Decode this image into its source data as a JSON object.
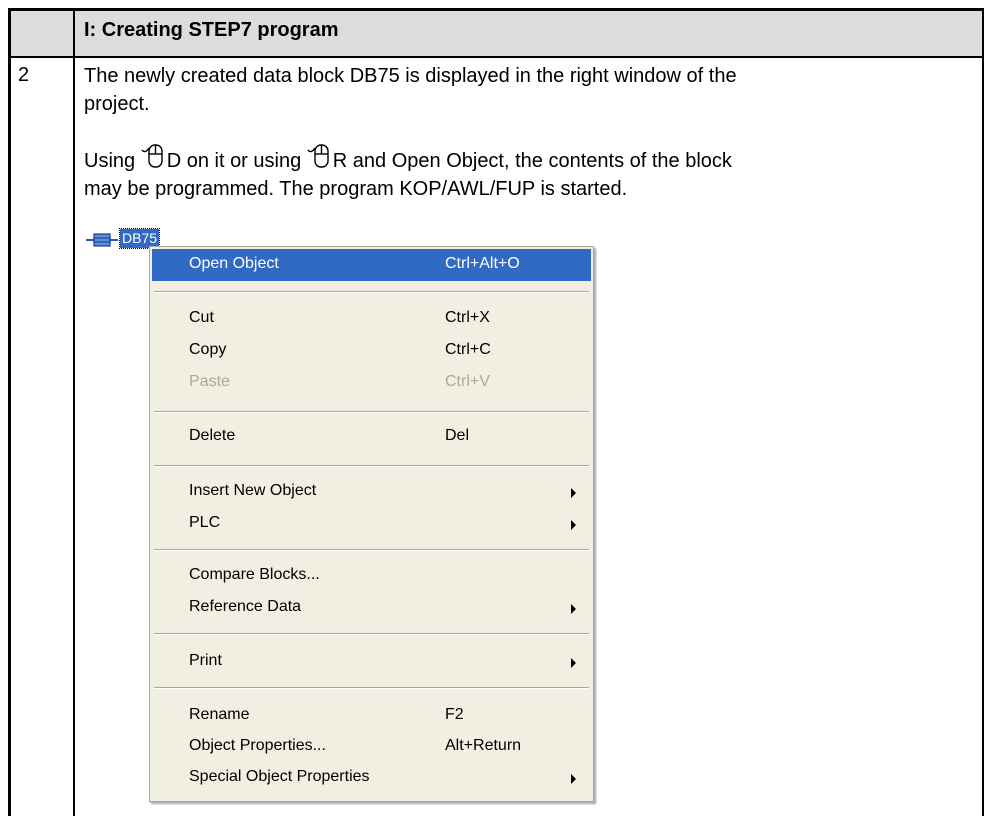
{
  "header": {
    "title": "I: Creating STEP7 program"
  },
  "row": {
    "number": "2",
    "line1": "The newly created data block DB75 is displayed in the right window of the",
    "line2": "project.",
    "line3_a": "Using ",
    "line3_b": "D on it or using ",
    "line3_c": "R and Open Object, the contents of the block",
    "line4": "may be programmed. The program KOP/AWL/FUP is started."
  },
  "tree": {
    "item_label": "DB75"
  },
  "context_menu": {
    "items": [
      {
        "label": "Open Object",
        "shortcut": "Ctrl+Alt+O"
      },
      {
        "label": "Cut",
        "shortcut": "Ctrl+X"
      },
      {
        "label": "Copy",
        "shortcut": "Ctrl+C"
      },
      {
        "label": "Paste",
        "shortcut": "Ctrl+V"
      },
      {
        "label": "Delete",
        "shortcut": "Del"
      },
      {
        "label": "Insert New Object",
        "shortcut": ""
      },
      {
        "label": "PLC",
        "shortcut": ""
      },
      {
        "label": "Compare Blocks...",
        "shortcut": ""
      },
      {
        "label": "Reference Data",
        "shortcut": ""
      },
      {
        "label": "Print",
        "shortcut": ""
      },
      {
        "label": "Rename",
        "shortcut": "F2"
      },
      {
        "label": "Object Properties...",
        "shortcut": "Alt+Return"
      },
      {
        "label": "Special Object Properties",
        "shortcut": ""
      }
    ]
  },
  "colors": {
    "highlight": "#316ac5",
    "menu_bg": "#f1efe2",
    "disabled": "#aca899",
    "header_bg": "#dcdcdc"
  }
}
